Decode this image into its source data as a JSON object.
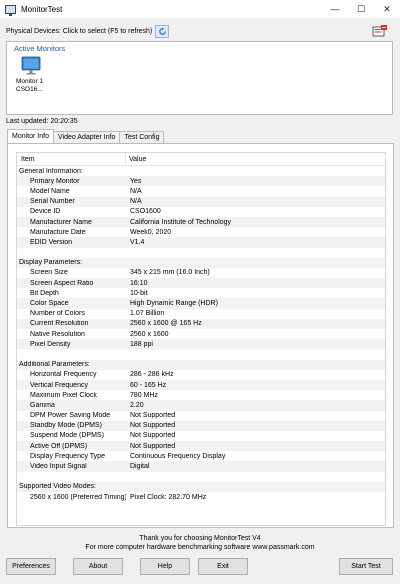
{
  "window": {
    "title": "MonitorTest",
    "minimize": "—",
    "maximize": "☐",
    "close": "✕"
  },
  "physical_devices": {
    "label": "Physical Devices: Click to select (F5 to refresh)"
  },
  "active_monitors": {
    "title": "Active Monitors",
    "monitor_label_line1": "Monitor 1",
    "monitor_label_line2": "CSO16..."
  },
  "last_updated": "Last updated: 20:20:35",
  "tabs": [
    "Monitor Info",
    "Video Adapter Info",
    "Test Config"
  ],
  "table": {
    "headers": [
      "Item",
      "Value"
    ],
    "rows": [
      {
        "type": "section",
        "item": "General Information:",
        "value": ""
      },
      {
        "type": "item",
        "item": "Primary Monitor",
        "value": "Yes"
      },
      {
        "type": "item",
        "item": "Model Name",
        "value": "N/A"
      },
      {
        "type": "item",
        "item": "Serial Number",
        "value": "N/A"
      },
      {
        "type": "item",
        "item": "Device ID",
        "value": "CSO1600"
      },
      {
        "type": "item",
        "item": "Manufacturer Name",
        "value": "California Institute of Technology"
      },
      {
        "type": "item",
        "item": "Manufacture Date",
        "value": "Week0, 2020"
      },
      {
        "type": "item",
        "item": "EDID Version",
        "value": "V1.4"
      },
      {
        "type": "blank",
        "item": "",
        "value": ""
      },
      {
        "type": "section",
        "item": "Display Parameters:",
        "value": ""
      },
      {
        "type": "item",
        "item": "Screen Size",
        "value": "345 x 215 mm (16.0 Inch)"
      },
      {
        "type": "item",
        "item": "Screen Aspect Ratio",
        "value": "16:10"
      },
      {
        "type": "item",
        "item": "Bit Depth",
        "value": "10-bit"
      },
      {
        "type": "item",
        "item": "Color Space",
        "value": "High Dynamic Range (HDR)"
      },
      {
        "type": "item",
        "item": "Number of Colors",
        "value": "1.07 Billion"
      },
      {
        "type": "item",
        "item": "Current Resolution",
        "value": "2560 x 1600 @ 165 Hz"
      },
      {
        "type": "item",
        "item": "Native Resolution",
        "value": "2560 x 1600"
      },
      {
        "type": "item",
        "item": "Pixel Density",
        "value": "188 ppi"
      },
      {
        "type": "blank",
        "item": "",
        "value": ""
      },
      {
        "type": "section",
        "item": "Additional Parameters:",
        "value": ""
      },
      {
        "type": "item",
        "item": "Horizontal Frequency",
        "value": "286 - 286 kHz"
      },
      {
        "type": "item",
        "item": "Vertical Frequency",
        "value": "60 - 165 Hz"
      },
      {
        "type": "item",
        "item": "Maximum Pixel Clock",
        "value": "780 MHz"
      },
      {
        "type": "item",
        "item": "Gamma",
        "value": "2.20"
      },
      {
        "type": "item",
        "item": "DPM Power Saving Mode",
        "value": "Not Supported"
      },
      {
        "type": "item",
        "item": "Standby Mode (DPMS)",
        "value": "Not Supported"
      },
      {
        "type": "item",
        "item": "Suspend Mode (DPMS)",
        "value": "Not Supported"
      },
      {
        "type": "item",
        "item": "Active Off (DPMS)",
        "value": "Not Supported"
      },
      {
        "type": "item",
        "item": "Display Frequency Type",
        "value": "Continuous Frequency Display"
      },
      {
        "type": "item",
        "item": "Video Input Signal",
        "value": "Digital"
      },
      {
        "type": "blank",
        "item": "",
        "value": ""
      },
      {
        "type": "section",
        "item": "Supported Video Modes:",
        "value": ""
      },
      {
        "type": "item",
        "item": "2560 x 1600 (Preferred Timing)",
        "value": "Pixel Clock: 282.70 MHz"
      }
    ]
  },
  "footer": {
    "line1": "Thank you for choosing MonitorTest V4",
    "line2": "For more computer hardware benchmarking software www.passmark.com"
  },
  "buttons": {
    "preferences": "Preferences",
    "about": "About",
    "help": "Help",
    "exit": "Exit",
    "start_test": "Start Test"
  },
  "colors": {
    "accent": "#1f5fb0",
    "window_bg": "#f0f0f0"
  }
}
